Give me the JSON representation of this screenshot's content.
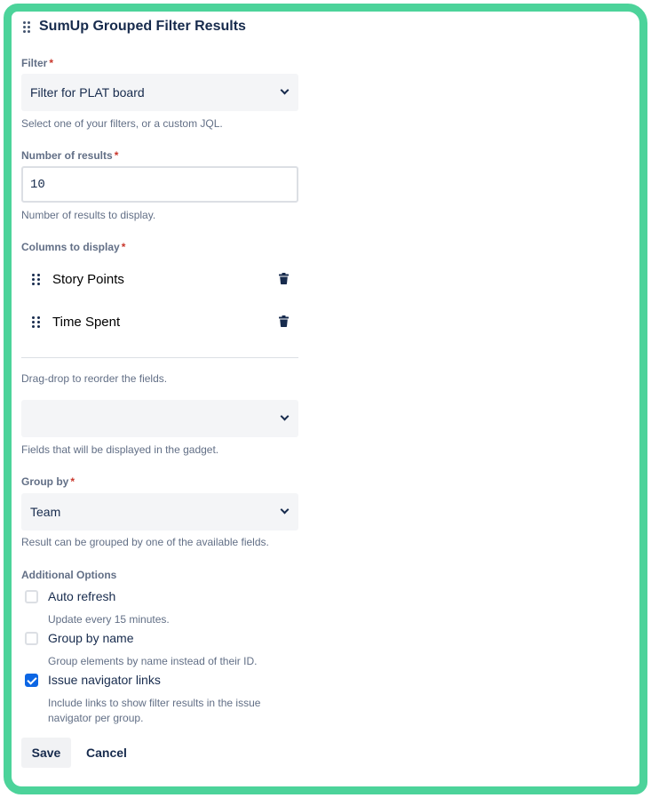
{
  "gadget": {
    "title": "SumUp Grouped Filter Results"
  },
  "filter": {
    "label": "Filter",
    "required_mark": "*",
    "value": "Filter for PLAT board",
    "help": "Select one of your filters, or a custom JQL."
  },
  "num_results": {
    "label": "Number of results",
    "required_mark": "*",
    "value": "10",
    "help": "Number of results to display."
  },
  "columns": {
    "label": "Columns to display",
    "required_mark": "*",
    "items": [
      {
        "label": "Story Points"
      },
      {
        "label": "Time Spent"
      }
    ],
    "reorder_help": "Drag-drop to reorder the fields.",
    "add_value": "",
    "add_help": "Fields that will be displayed in the gadget."
  },
  "group_by": {
    "label": "Group by",
    "required_mark": "*",
    "value": "Team",
    "help": "Result can be grouped by one of the available fields."
  },
  "options": {
    "label": "Additional Options",
    "items": [
      {
        "label": "Auto refresh",
        "help": "Update every 15 minutes.",
        "checked": false
      },
      {
        "label": "Group by name",
        "help": "Group elements by name instead of their ID.",
        "checked": false
      },
      {
        "label": "Issue navigator links",
        "help": "Include links to show filter results in the issue navigator per group.",
        "checked": true
      }
    ]
  },
  "actions": {
    "save": "Save",
    "cancel": "Cancel"
  },
  "colors": {
    "frame": "#4cd39a",
    "checked": "#0c66e4",
    "required": "#c9372c"
  },
  "icons": {
    "title_drag": "drag-handle-icon",
    "column_drag": "drag-handle-icon",
    "remove": "trash-icon",
    "dropdown": "chevron-down-icon"
  }
}
